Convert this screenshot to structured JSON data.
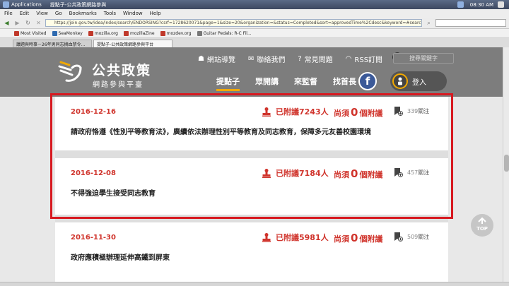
{
  "os": {
    "applications": "Applications",
    "window_title": "提點子-公共政策網路參與",
    "clock": "08:30 AM"
  },
  "browser": {
    "menu": [
      "File",
      "Edit",
      "View",
      "Go",
      "Bookmarks",
      "Tools",
      "Window",
      "Help"
    ],
    "url": "https://join.gov.tw/idea/index/search/ENDORSING?csrf=1728620071&page=1&size=20&organization=&status=Completed&sort=approvedTime%2Cdesc&keyword=#search",
    "bookmarks": [
      "Most Visited",
      "SeaMonkey",
      "mozilla.org",
      "mozillaZine",
      "mozdev.org",
      "Guitar Pedals: R-C Fil..."
    ],
    "tabs": [
      "議題與時事－26年男同志摘血禁令…",
      "提點子-公共政策網路參與平台"
    ]
  },
  "site": {
    "logo_title": "公共政策",
    "logo_subtitle": "網路參與平臺",
    "top_links": [
      "網站導覽",
      "聯絡我們",
      "常見問題",
      "RSS訂閱"
    ],
    "search_placeholder": "搜尋關鍵字",
    "nav": [
      "提點子",
      "眾開講",
      "來監督",
      "找首長"
    ],
    "facebook": "f",
    "login": "登入",
    "need_prefix": "尚須",
    "need_count": "0",
    "need_suffix": "個附議",
    "follow_suffix": "關注",
    "top_button": "TOP"
  },
  "ideas": [
    {
      "date": "2016-12-16",
      "signed": "已附議7243人",
      "follows": "339",
      "title": "請政府恪遵《性別平等教育法》，廣續依法辦理性別平等教育及同志教育，保障多元友善校園環境"
    },
    {
      "date": "2016-12-08",
      "signed": "已附議7184人",
      "follows": "457",
      "title": "不得強迫學生接受同志教育"
    },
    {
      "date": "2016-11-30",
      "signed": "已附議5981人",
      "follows": "509",
      "title": "政府應積極辦理延伸高鐵到屏東"
    }
  ]
}
